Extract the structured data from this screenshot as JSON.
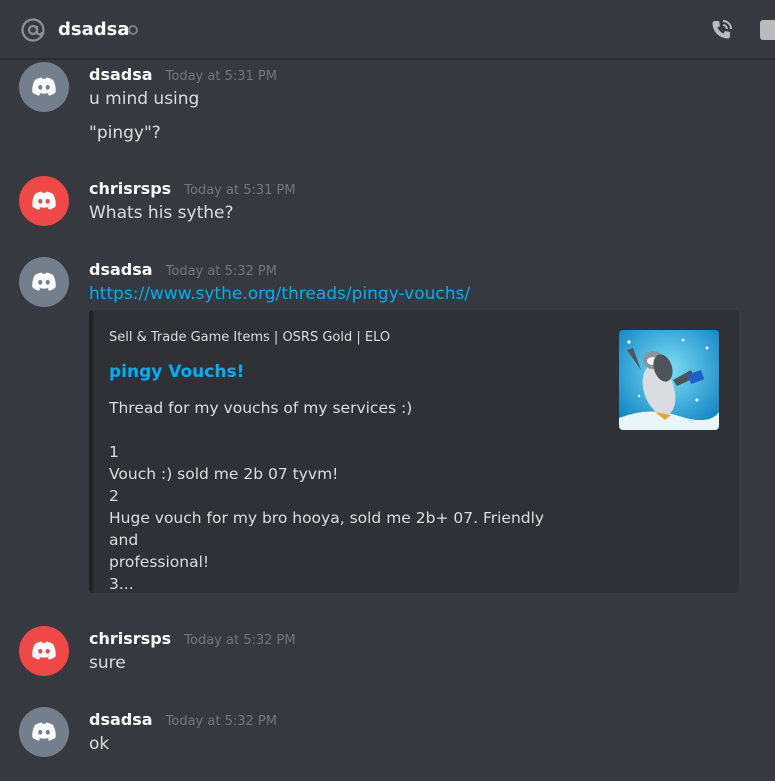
{
  "header": {
    "channel_name": "dsadsa",
    "at_icon": "at-icon",
    "call_icon": "phone-call-icon",
    "video_icon": "video-icon"
  },
  "colors": {
    "background": "#36393f",
    "embed_bg": "#2f3136",
    "link": "#00b0f4",
    "avatar_gray": "#747f8d",
    "avatar_red": "#f04747"
  },
  "messages": [
    {
      "author": "dsadsa",
      "timestamp": "Today at 5:31 PM",
      "lines": [
        "u mind using",
        "\"pingy\"?"
      ]
    },
    {
      "author": "chrisrsps",
      "timestamp": "Today at 5:31 PM",
      "lines": [
        "Whats his sythe?"
      ]
    },
    {
      "author": "dsadsa",
      "timestamp": "Today at 5:32 PM",
      "link": "https://www.sythe.org/threads/pingy-vouchs/",
      "embed": {
        "provider": "Sell & Trade Game Items | OSRS Gold | ELO",
        "title": "pingy Vouchs!",
        "description": [
          "Thread for my vouchs of my services :)",
          "",
          "1",
          "Vouch :) sold me 2b 07 tyvm!",
          "2",
          "Huge vouch for my bro hooya, sold me 2b+ 07. Friendly and",
          "professional!",
          "3..."
        ],
        "thumbnail_icon": "penguin-thumbnail-image"
      }
    },
    {
      "author": "chrisrsps",
      "timestamp": "Today at 5:32 PM",
      "lines": [
        "sure"
      ]
    },
    {
      "author": "dsadsa",
      "timestamp": "Today at 5:32 PM",
      "lines": [
        "ok"
      ]
    }
  ]
}
